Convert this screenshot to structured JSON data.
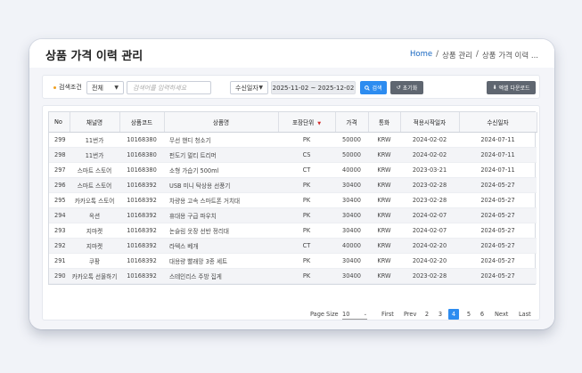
{
  "header": {
    "title": "상품 가격 이력 관리",
    "breadcrumb": [
      "Home",
      "/",
      "상품 관리",
      "/",
      "상품 가격 이력 ..."
    ]
  },
  "filters": {
    "search_label": "검색조건",
    "search_type": "전체",
    "search_placeholder": "검색어를 입력하세요",
    "date_type": "수신일자",
    "date_range": "2025-11-02 ~ 2025-12-02",
    "search_button": "검색",
    "reset_button": "초기화",
    "excel_button": "엑셀 다운로드"
  },
  "table": {
    "columns": [
      "No",
      "채널명",
      "상품코드",
      "상품명",
      "포장단위",
      "가격",
      "통화",
      "적용시작일자",
      "수신일자"
    ],
    "rows": [
      [
        "299",
        "11번가",
        "10168380",
        "무선 핸디 청소기",
        "PK",
        "50000",
        "KRW",
        "2024-02-02",
        "2024-07-11"
      ],
      [
        "298",
        "11번가",
        "10168380",
        "펀도기 멀티 트리머",
        "CS",
        "50000",
        "KRW",
        "2024-02-02",
        "2024-07-11"
      ],
      [
        "297",
        "스마트 스토어",
        "10168380",
        "소형 가습기 500ml",
        "CT",
        "40000",
        "KRW",
        "2023-03-21",
        "2024-07-11"
      ],
      [
        "296",
        "스마트 스토어",
        "10168392",
        "USB 미니 탁상용 선풍기",
        "PK",
        "30400",
        "KRW",
        "2023-02-28",
        "2024-05-27"
      ],
      [
        "295",
        "카카오톡 스토어",
        "10168392",
        "차량용 고속 스마트폰 거치대",
        "PK",
        "30400",
        "KRW",
        "2023-02-28",
        "2024-05-27"
      ],
      [
        "294",
        "옥션",
        "10168392",
        "휴대용 구급 파우치",
        "PK",
        "30400",
        "KRW",
        "2024-02-07",
        "2024-05-27"
      ],
      [
        "293",
        "지마켓",
        "10168392",
        "논슬림 옷장 선반 정리대",
        "PK",
        "30400",
        "KRW",
        "2024-02-07",
        "2024-05-27"
      ],
      [
        "292",
        "지마켓",
        "10168392",
        "라텍스 베개",
        "CT",
        "40000",
        "KRW",
        "2024-02-20",
        "2024-05-27"
      ],
      [
        "291",
        "쿠팡",
        "10168392",
        "대용량 빨래망 3종 세트",
        "PK",
        "30400",
        "KRW",
        "2024-02-20",
        "2024-05-27"
      ],
      [
        "290",
        "카카오톡 선물하기",
        "10168392",
        "스테인리스 주방 집게",
        "PK",
        "30400",
        "KRW",
        "2023-02-28",
        "2024-05-27"
      ]
    ]
  },
  "pager": {
    "page_size_label": "Page Size",
    "page_size": "10",
    "first": "First",
    "prev": "Prev",
    "pages": [
      "2",
      "3",
      "4",
      "5",
      "6"
    ],
    "active_page": "4",
    "next": "Next",
    "last": "Last"
  },
  "colors": {
    "accent": "#2d8cf0",
    "sort_indicator": "#d32f2f",
    "dark_button": "#5f6670"
  }
}
